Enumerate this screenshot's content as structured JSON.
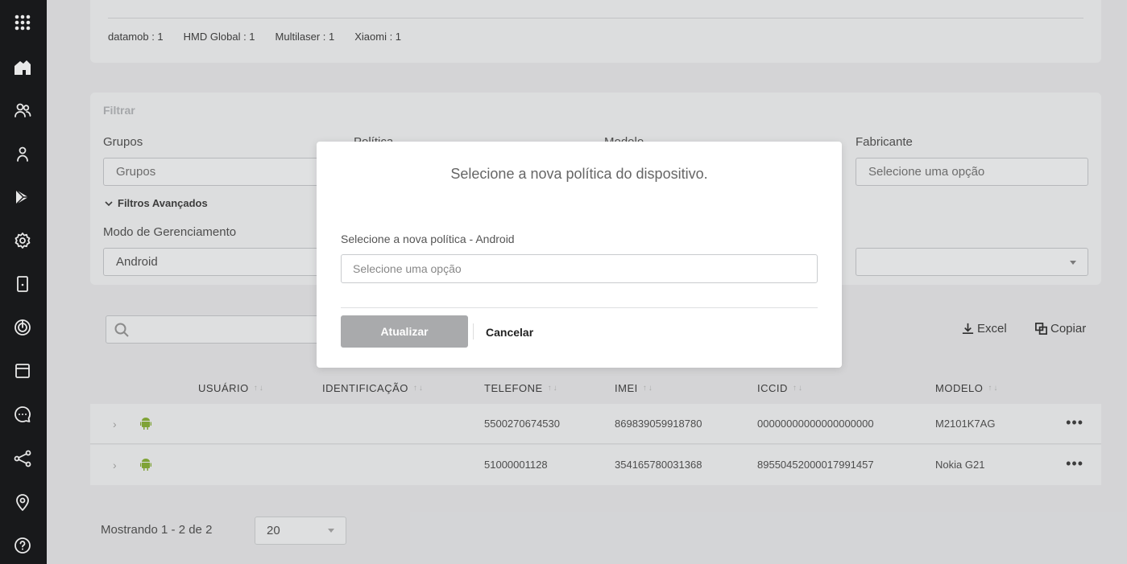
{
  "sidebar": {
    "items": [
      "apps-grid-icon",
      "home-icon",
      "users-icon",
      "user-icon",
      "play-store-icon",
      "settings-icon",
      "device-icon",
      "radar-icon",
      "window-icon",
      "chat-icon",
      "share-icon",
      "location-icon",
      "help-icon"
    ]
  },
  "summary": {
    "items": [
      "datamob : 1",
      "HMD Global : 1",
      "Multilaser : 1",
      "Xiaomi : 1"
    ]
  },
  "filter": {
    "title": "Filtrar",
    "groups_label": "Grupos",
    "groups_placeholder": "Grupos",
    "policy_label": "Política",
    "model_label": "Modelo",
    "manufacturer_label": "Fabricante",
    "manufacturer_placeholder": "Selecione uma opção",
    "advanced_label": "Filtros Avançados",
    "mode_label": "Modo de Gerenciamento",
    "mode_value": "Android"
  },
  "toolbar": {
    "excel_label": "Excel",
    "copy_label": "Copiar"
  },
  "table": {
    "columns": [
      "USUÁRIO",
      "IDENTIFICAÇÃO",
      "TELEFONE",
      "IMEI",
      "ICCID",
      "MODELO"
    ],
    "rows": [
      {
        "usuario": "",
        "identificacao": "",
        "telefone": "5500270674530",
        "imei": "869839059918780",
        "iccid": "00000000000000000000",
        "modelo": "M2101K7AG"
      },
      {
        "usuario": "",
        "identificacao": "",
        "telefone": "51000001128",
        "imei": "354165780031368",
        "iccid": "89550452000017991457",
        "modelo": "Nokia G21"
      }
    ]
  },
  "pagination": {
    "showing": "Mostrando 1 - 2 de 2",
    "per_page": "20"
  },
  "modal": {
    "title": "Selecione a nova política do dispositivo.",
    "label": "Selecione a nova política - Android",
    "placeholder": "Selecione uma opção",
    "update_label": "Atualizar",
    "cancel_label": "Cancelar"
  },
  "colors": {
    "sidebar_bg": "#1b1c1e",
    "android_green": "#8cb43c",
    "update_button": "#a9aaac"
  }
}
